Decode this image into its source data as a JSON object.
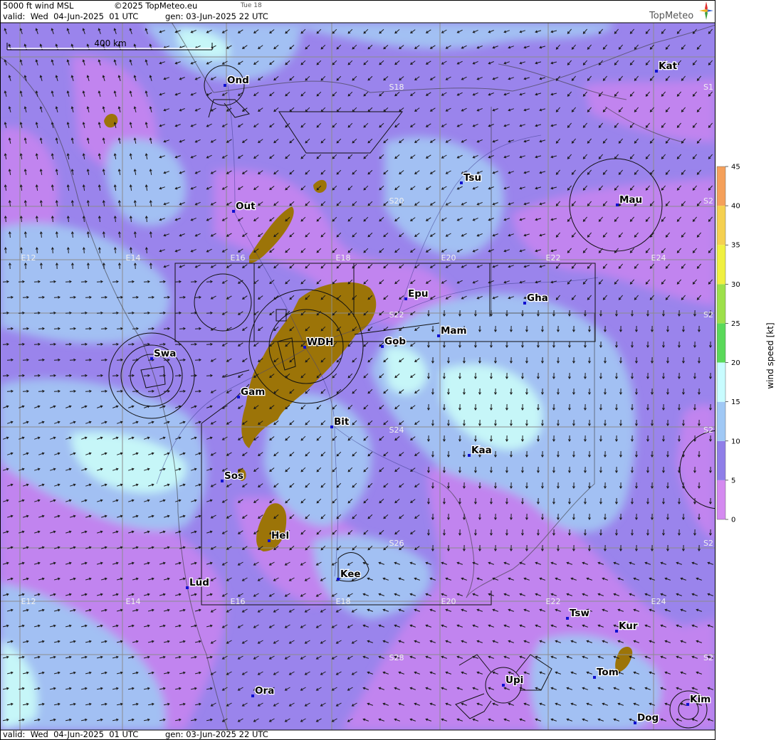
{
  "header": {
    "title": "5000 ft wind MSL",
    "copyright": "©2025 TopMeteo.eu",
    "day": "Tue 18",
    "valid": "valid:  Wed  04-Jun-2025  01 UTC",
    "gen": "gen: 03-Jun-2025 22 UTC",
    "brand": "TopMeteo"
  },
  "footer": {
    "valid": "valid:  Wed  04-Jun-2025  01 UTC",
    "gen": "gen: 03-Jun-2025 22 UTC"
  },
  "scale_bar": {
    "label": "400 km"
  },
  "legend": {
    "axis_label": "wind speed [kt]",
    "ticks": [
      "45",
      "40",
      "35",
      "30",
      "25",
      "20",
      "15",
      "10",
      "5",
      "0"
    ],
    "colors": [
      "#ef6f5f",
      "#f5a05a",
      "#f5d050",
      "#f0f040",
      "#9de04a",
      "#5ad95a",
      "#c8fcff",
      "#a0c8f5",
      "#8f7ee8",
      "#d48af0"
    ]
  },
  "map": {
    "colors": {
      "calm": "#c184ef",
      "light": "#9a84ec",
      "moderate": "#a2c0f3",
      "fresh": "#c6f6f8",
      "terrain": "#9c7408",
      "grid": "#8c8c8c",
      "border": "#3a3a3a"
    },
    "lon_labels": [
      "E12",
      "E14",
      "E16",
      "E18",
      "E20",
      "E22",
      "E24"
    ],
    "lat_labels": [
      "S18",
      "S20",
      "S22",
      "S24",
      "S26",
      "S28"
    ],
    "edge_lat_labels": [
      "S1",
      "S2",
      "S2",
      "S2",
      "S2",
      "S2"
    ],
    "cities": [
      {
        "name": "Ond"
      },
      {
        "name": "Kat"
      },
      {
        "name": "Tsu"
      },
      {
        "name": "Out"
      },
      {
        "name": "Mau"
      },
      {
        "name": "Epu"
      },
      {
        "name": "Gha"
      },
      {
        "name": "WDH"
      },
      {
        "name": "Mam"
      },
      {
        "name": "Gob"
      },
      {
        "name": "Swa"
      },
      {
        "name": "Gam"
      },
      {
        "name": "Bit"
      },
      {
        "name": "Kaa"
      },
      {
        "name": "Sos"
      },
      {
        "name": "Hel"
      },
      {
        "name": "Kee"
      },
      {
        "name": "Lud"
      },
      {
        "name": "Tsw"
      },
      {
        "name": "Kur"
      },
      {
        "name": "Tom"
      },
      {
        "name": "Upi"
      },
      {
        "name": "Ora"
      },
      {
        "name": "Kim"
      },
      {
        "name": "Dog"
      }
    ]
  }
}
